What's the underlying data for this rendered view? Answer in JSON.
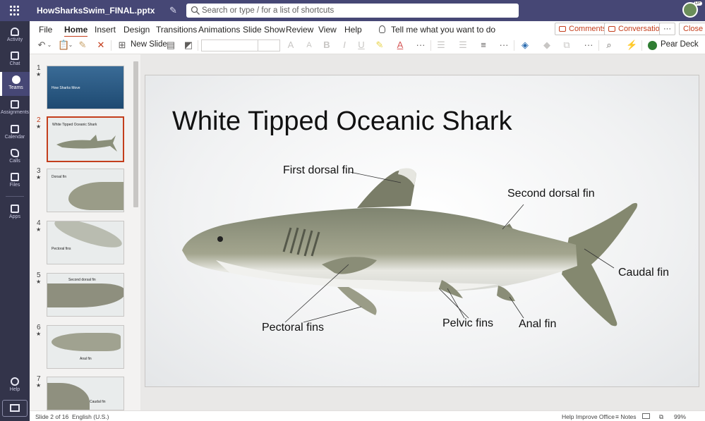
{
  "app": {
    "doc_title": "HowSharksSwim_FINAL.pptx",
    "search_placeholder": "Search or type / for a list of shortcuts",
    "user_initials": "DF"
  },
  "rail": [
    {
      "label": "Activity"
    },
    {
      "label": "Chat"
    },
    {
      "label": "Teams"
    },
    {
      "label": "Assignments"
    },
    {
      "label": "Calendar"
    },
    {
      "label": "Calls"
    },
    {
      "label": "Files"
    },
    {
      "label": "Apps"
    },
    {
      "label": "Help"
    }
  ],
  "ribbon": {
    "tabs": [
      "File",
      "Home",
      "Insert",
      "Design",
      "Transitions",
      "Animations",
      "Slide Show",
      "Review",
      "View",
      "Help"
    ],
    "tell_me": "Tell me what you want to do",
    "comments": "Comments",
    "conversation": "Conversation",
    "more": "···",
    "close": "Close"
  },
  "toolbar": {
    "new_slide": "New Slide",
    "pear_deck": "Pear Deck"
  },
  "thumbnails": [
    {
      "num": "1",
      "title": "How Sharks Move"
    },
    {
      "num": "2",
      "title": "White Tipped Oceanic Shark"
    },
    {
      "num": "3",
      "title": "Dorsal fin"
    },
    {
      "num": "4",
      "title": "Pectoral fins"
    },
    {
      "num": "5",
      "title": "Second dorsal fin"
    },
    {
      "num": "6",
      "title": "Anal fin"
    },
    {
      "num": "7",
      "title": "Caudal fin"
    }
  ],
  "slide": {
    "title": "White Tipped Oceanic Shark",
    "labels": {
      "first_dorsal": "First dorsal fin",
      "second_dorsal": "Second dorsal fin",
      "caudal": "Caudal fin",
      "pectoral": "Pectoral fins",
      "pelvic": "Pelvic fins",
      "anal": "Anal fin"
    }
  },
  "status": {
    "slide_count": "Slide 2 of 16",
    "language": "English (U.S.)",
    "improve": "Help Improve Office",
    "notes": "Notes",
    "zoom": "99%"
  },
  "colors": {
    "teams_purple": "#464775",
    "rail": "#33344a",
    "accent": "#c43e1c"
  }
}
